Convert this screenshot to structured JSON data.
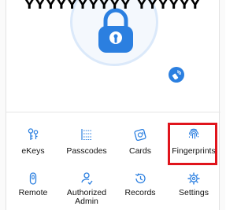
{
  "header": {
    "partial_text": "ʏʏʏʏʏʏʏʏʏʏ ʏʏʏʏʏʏ"
  },
  "lock": {
    "icon": "padlock-icon",
    "accent": "#2b7fe0"
  },
  "remote_fab": {
    "icon": "remote-control-icon"
  },
  "features": {
    "items": [
      {
        "label": "eKeys",
        "icon": "ekey-icon"
      },
      {
        "label": "Passcodes",
        "icon": "passcode-icon"
      },
      {
        "label": "Cards",
        "icon": "card-icon"
      },
      {
        "label": "Fingerprints",
        "icon": "fingerprint-icon"
      },
      {
        "label": "Remote",
        "icon": "remote-icon"
      },
      {
        "label": "Authorized Admin",
        "icon": "admin-icon"
      },
      {
        "label": "Records",
        "icon": "records-icon"
      },
      {
        "label": "Settings",
        "icon": "settings-icon"
      }
    ]
  },
  "highlight_color": "#e0141c"
}
